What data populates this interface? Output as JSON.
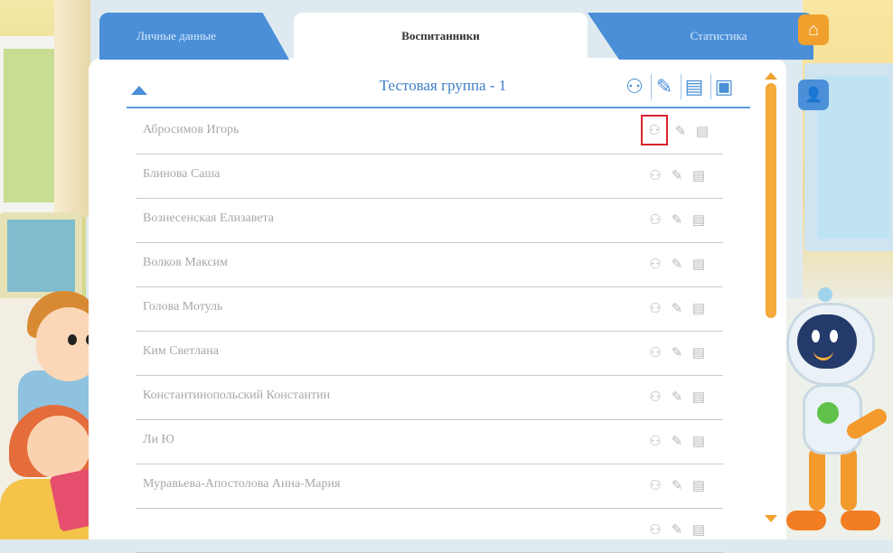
{
  "tabs": {
    "personal": "Личные данные",
    "education": "Воспитанники",
    "statistics": "Статистика"
  },
  "group": {
    "title": "Тестовая группа - 1"
  },
  "icons": {
    "home": "home-icon",
    "side": "user-chart-icon",
    "header": [
      "users-icon",
      "edit-icon",
      "document-icon",
      "document-filled-icon"
    ],
    "row": [
      "users-icon",
      "edit-icon",
      "document-icon"
    ]
  },
  "students": [
    {
      "name": "Абросимов Игорь"
    },
    {
      "name": "Блинова Саша"
    },
    {
      "name": "Вознесенская Елизавета"
    },
    {
      "name": "Волков Максим"
    },
    {
      "name": "Голова Мотуль"
    },
    {
      "name": "Ким Светлана"
    },
    {
      "name": "Константинопольский Константин"
    },
    {
      "name": "Ли Ю"
    },
    {
      "name": "Муравьева-Апостолова Анна-Мария"
    },
    {
      "name": ""
    }
  ],
  "colors": {
    "accent": "#4a8fd8",
    "tab_active_bg": "#ffffff",
    "highlight": "#d9232e",
    "scroll": "#f5a93a"
  }
}
